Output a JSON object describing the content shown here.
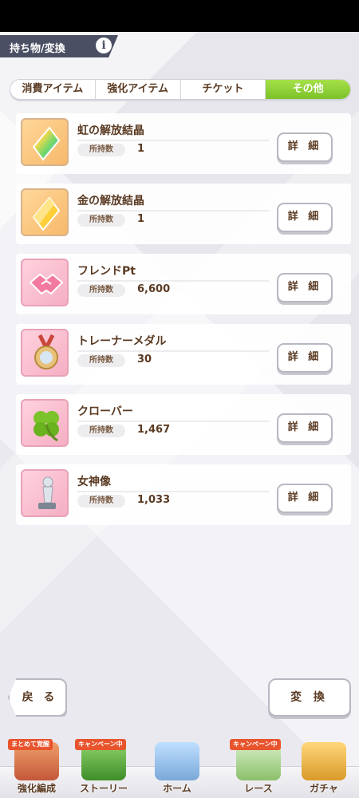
{
  "header": {
    "title": "持ち物/変換",
    "info_icon": "i"
  },
  "tabs": [
    {
      "label": "消費アイテム",
      "active": false
    },
    {
      "label": "強化アイテム",
      "active": false
    },
    {
      "label": "チケット",
      "active": false
    },
    {
      "label": "その他",
      "active": true
    }
  ],
  "items": [
    {
      "name": "虹の解放結晶",
      "qty_label": "所持数",
      "qty": "1",
      "detail_label": "詳 細",
      "icon": "rainbow-crystal-icon"
    },
    {
      "name": "金の解放結晶",
      "qty_label": "所持数",
      "qty": "1",
      "detail_label": "詳 細",
      "icon": "gold-crystal-icon"
    },
    {
      "name": "フレンドPt",
      "qty_label": "所持数",
      "qty": "6,600",
      "detail_label": "詳 細",
      "icon": "handshake-icon"
    },
    {
      "name": "トレーナーメダル",
      "qty_label": "所持数",
      "qty": "30",
      "detail_label": "詳 細",
      "icon": "medal-icon"
    },
    {
      "name": "クローバー",
      "qty_label": "所持数",
      "qty": "1,467",
      "detail_label": "詳 細",
      "icon": "clover-icon"
    },
    {
      "name": "女神像",
      "qty_label": "所持数",
      "qty": "1,033",
      "detail_label": "詳 細",
      "icon": "goddess-statue-icon"
    }
  ],
  "footer": {
    "back_label": "戻 る",
    "exchange_label": "変 換"
  },
  "nav": [
    {
      "label": "強化編成",
      "badge": "まとめて覚醒"
    },
    {
      "label": "ストーリー",
      "badge": "キャンペーン中"
    },
    {
      "label": "ホーム",
      "badge": ""
    },
    {
      "label": "レース",
      "badge": "キャンペーン中"
    },
    {
      "label": "ガチャ",
      "badge": ""
    }
  ],
  "colors": {
    "accent_green": "#7cc22a",
    "header": "#4a4f63",
    "text_brown": "#5a3a22"
  }
}
